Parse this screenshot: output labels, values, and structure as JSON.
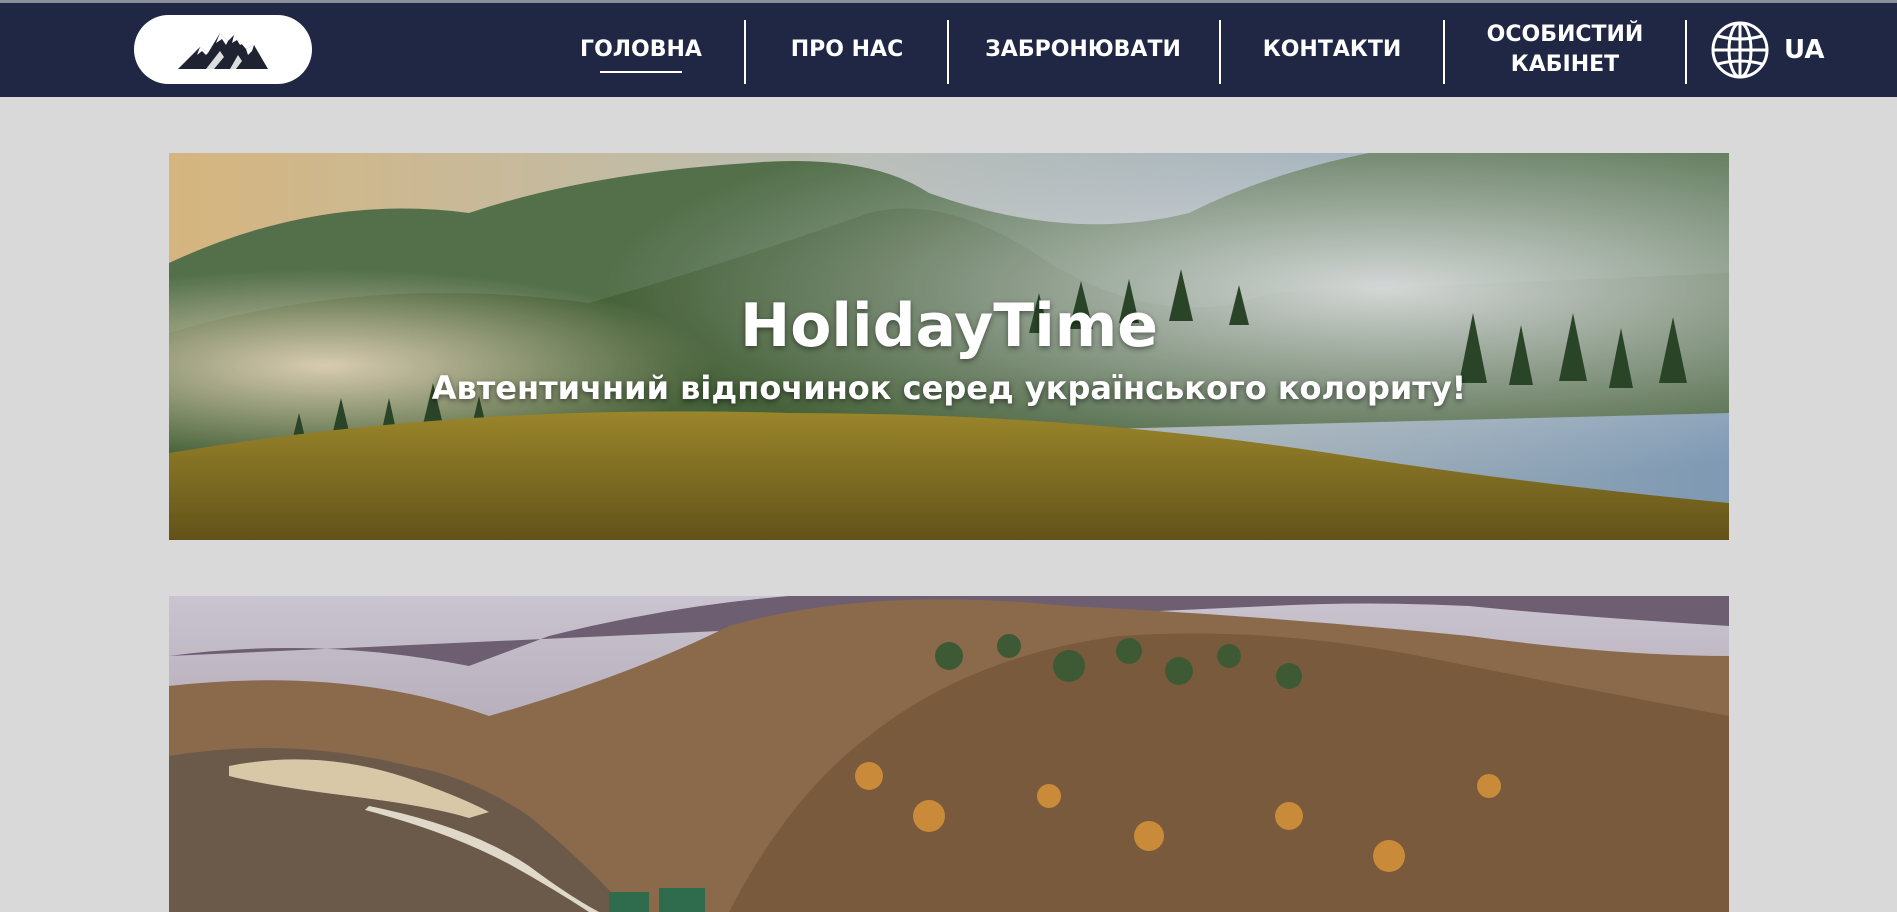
{
  "header": {
    "logo_alt": "mountain-logo",
    "nav": [
      {
        "label": "ГОЛОВНА",
        "active": true
      },
      {
        "label": "ПРО НАС",
        "active": false
      },
      {
        "label": "ЗАБРОНЮВАТИ",
        "active": false
      },
      {
        "label": "КОНТАКТИ",
        "active": false
      },
      {
        "label_line1": "ОСОБИСТИЙ",
        "label_line2": "КАБІНЕТ",
        "active": false
      }
    ],
    "language": "UA",
    "colors": {
      "bar": "#1f2744",
      "text": "#ffffff",
      "page_bg": "#d9d9d9"
    }
  },
  "hero": {
    "title": "HolidayTime",
    "subtitle": "Автентичний відпочинок серед українського колориту!"
  }
}
